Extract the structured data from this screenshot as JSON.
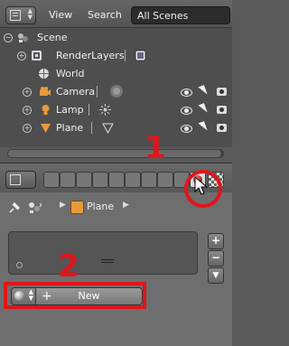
{
  "outliner": {
    "menu": {
      "view": "View",
      "search": "Search"
    },
    "scene_select": "All Scenes",
    "items": [
      {
        "label": "Scene"
      },
      {
        "label": "RenderLayers"
      },
      {
        "label": "World"
      },
      {
        "label": "Camera"
      },
      {
        "label": "Lamp"
      },
      {
        "label": "Plane"
      }
    ]
  },
  "annotations": {
    "step1": "1",
    "step2": "2"
  },
  "properties": {
    "breadcrumb": {
      "object": "Plane"
    },
    "material": {
      "new_label": "New"
    }
  },
  "colors": {
    "annotation_red": "#e0151c",
    "object_orange": "#e79a3c"
  }
}
